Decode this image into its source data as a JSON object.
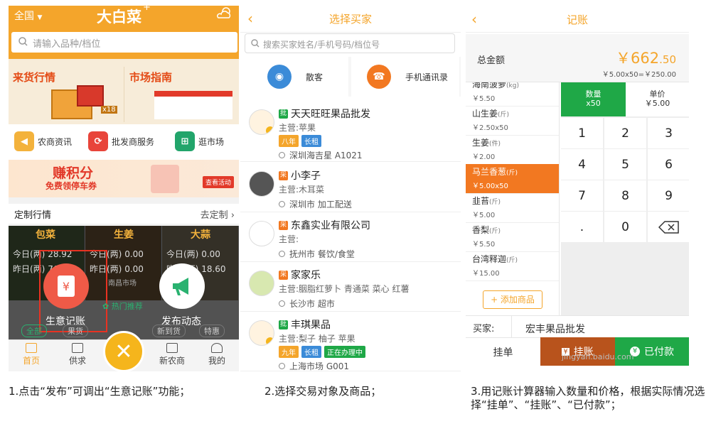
{
  "phone1": {
    "city": "全国",
    "logo": "大白菜",
    "search_placeholder": "请输入品种/档位",
    "banner_left": "来货行情",
    "banner_right": "市场指南",
    "crate_badge": "x18",
    "shortcuts": [
      "农商资讯",
      "批发商服务",
      "逛市场"
    ],
    "promo_title": "赚积分",
    "promo_sub": "免费领停车券",
    "promo_btn": "查看活动",
    "custom_title": "定制行情",
    "custom_link": "去定制",
    "veg": [
      {
        "name": "包菜",
        "today": "今日(两)",
        "today_val": "28.92",
        "yest": "昨日(两)",
        "yest_val": "76"
      },
      {
        "name": "生姜",
        "today": "今日(两)",
        "today_val": "0.00",
        "yest": "昨日(两)",
        "yest_val": "0.00",
        "market": "南昌市场"
      },
      {
        "name": "大蒜",
        "today": "今日(两)",
        "today_val": "0.00",
        "yest": "昨日(两)",
        "yest_val": "18.60"
      }
    ],
    "action_ledger": "生意记账",
    "action_post": "发布动态",
    "hot": "热门推荐",
    "tabs": [
      "全部",
      "果货",
      "",
      "新到货",
      "特惠"
    ],
    "nav": [
      "首页",
      "供求",
      "",
      "新农商",
      "我的"
    ]
  },
  "phone2": {
    "title": "选择买家",
    "search_placeholder": "搜索买家姓名/手机号码/档位号",
    "quick": [
      "散客",
      "手机通讯录"
    ],
    "buyers": [
      {
        "type": "批",
        "name": "天天旺旺果品批发",
        "main": "主营:苹果",
        "tags": [
          "八年",
          "长租"
        ],
        "loc": "深圳海吉星 A1021"
      },
      {
        "type": "采",
        "name": "小李子",
        "main": "主营:木耳菜",
        "tags": [],
        "loc": "深圳市 加工配送"
      },
      {
        "type": "采",
        "name": "东鑫实业有限公司",
        "main": "主营:",
        "tags": [],
        "loc": "抚州市 餐饮/食堂"
      },
      {
        "type": "采",
        "name": "家家乐",
        "main": "主营:胭脂红萝卜 青通菜 菜心 红薯",
        "tags": [],
        "loc": "长沙市 超市"
      },
      {
        "type": "批",
        "name": "丰琪果品",
        "main": "主营:梨子 柚子 苹果",
        "tags": [
          "九年",
          "长租",
          "正在办理中"
        ],
        "loc": "上海市场 G001"
      }
    ]
  },
  "phone3": {
    "title": "记账",
    "total_label": "总金额",
    "total_currency": "￥",
    "total_int": "662",
    "total_dec": ".50",
    "total_formula": "￥5.00x50=￥250.00",
    "products": [
      {
        "name": "海南菠萝",
        "unit": "(kg)",
        "price": "￥5.50"
      },
      {
        "name": "山生姜",
        "unit": "(斤)",
        "price": "￥2.50x50"
      },
      {
        "name": "生姜",
        "unit": "(件)",
        "price": "￥2.00"
      },
      {
        "name": "马兰香葱",
        "unit": "(斤)",
        "price": "￥5.00x50"
      },
      {
        "name": "韭苔",
        "unit": "(斤)",
        "price": "￥5.00"
      },
      {
        "name": "香梨",
        "unit": "(斤)",
        "price": "￥5.50"
      },
      {
        "name": "台湾释迦",
        "unit": "(斤)",
        "price": "￥15.00"
      }
    ],
    "add_product": "+ 添加商品",
    "qty_label": "数量",
    "qty_value": "x50",
    "price_label": "单价",
    "price_value": "￥5.00",
    "keys": [
      "1",
      "2",
      "3",
      "4",
      "5",
      "6",
      "7",
      "8",
      "9",
      ".",
      "0",
      "⌫"
    ],
    "buyer_label": "买家:",
    "buyer_name": "宏丰果品批发",
    "btn_hold": "挂单",
    "btn_credit": "挂账",
    "btn_paid": "已付款"
  },
  "captions": [
    "1.点击“发布”可调出“生意记账”功能；",
    "2.选择交易对象及商品；",
    "3.用记账计算器输入数量和价格，根据实际情况选择“挂单”、“挂账”、“已付款”；"
  ],
  "watermark": "jingyan.baidu.com",
  "colors": {
    "orange": "#f4a52b",
    "deep_orange": "#f27821",
    "green": "#1fa847",
    "red": "#e83222"
  }
}
